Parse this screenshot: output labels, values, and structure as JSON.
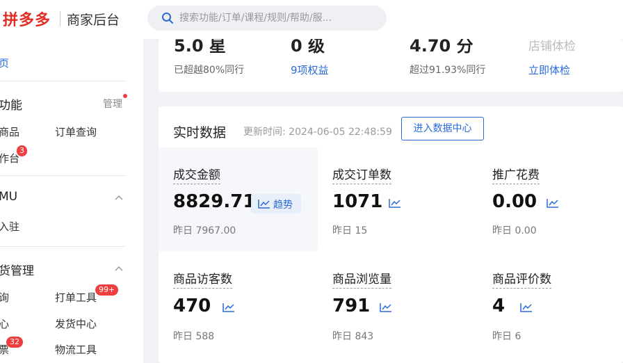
{
  "header": {
    "logo": "拼多多",
    "subtitle": "商家后台",
    "search_placeholder": "搜索功能/订单/课程/规则/帮助/服..."
  },
  "sidebar": {
    "home": "页",
    "common": {
      "title": "功能",
      "manage": "管理",
      "items": [
        "商品",
        "订单查询",
        "作台"
      ],
      "badge": "3"
    },
    "temu": {
      "title": "MU",
      "items": [
        "入驻"
      ]
    },
    "shipping": {
      "title": "货管理",
      "items": [
        "询",
        "打单工具",
        "心",
        "发货中心",
        "票",
        "物流工具"
      ],
      "badge_print": "99+",
      "badge_ticket": "32"
    }
  },
  "top_stats": [
    {
      "value": "5.0 星",
      "sub": "已超越80%同行"
    },
    {
      "value": "0 级",
      "sub": "9项权益"
    },
    {
      "value": "4.70 分",
      "sub": "超过91.93%同行"
    },
    {
      "value": "店铺体检",
      "sub": "立即体检"
    }
  ],
  "realtime": {
    "title": "实时数据",
    "update_time": "更新时间: 2024-06-05 22:48:59",
    "enter_button": "进入数据中心",
    "trend_label": "趋势",
    "metrics": [
      {
        "label": "成交金额",
        "value": "8829.71",
        "prev": "昨日 7967.00"
      },
      {
        "label": "成交订单数",
        "value": "1071",
        "prev": "昨日 15"
      },
      {
        "label": "推广花费",
        "value": "0.00",
        "prev": "昨日 0.00"
      },
      {
        "label": "商品访客数",
        "value": "470",
        "prev": "昨日 588"
      },
      {
        "label": "商品浏览量",
        "value": "791",
        "prev": "昨日 843"
      },
      {
        "label": "商品评价数",
        "value": "4",
        "prev": "昨日 6"
      }
    ]
  },
  "colors": {
    "brand": "#e02e24",
    "accent": "#2a6ad9",
    "badge": "#ef3e3e"
  }
}
